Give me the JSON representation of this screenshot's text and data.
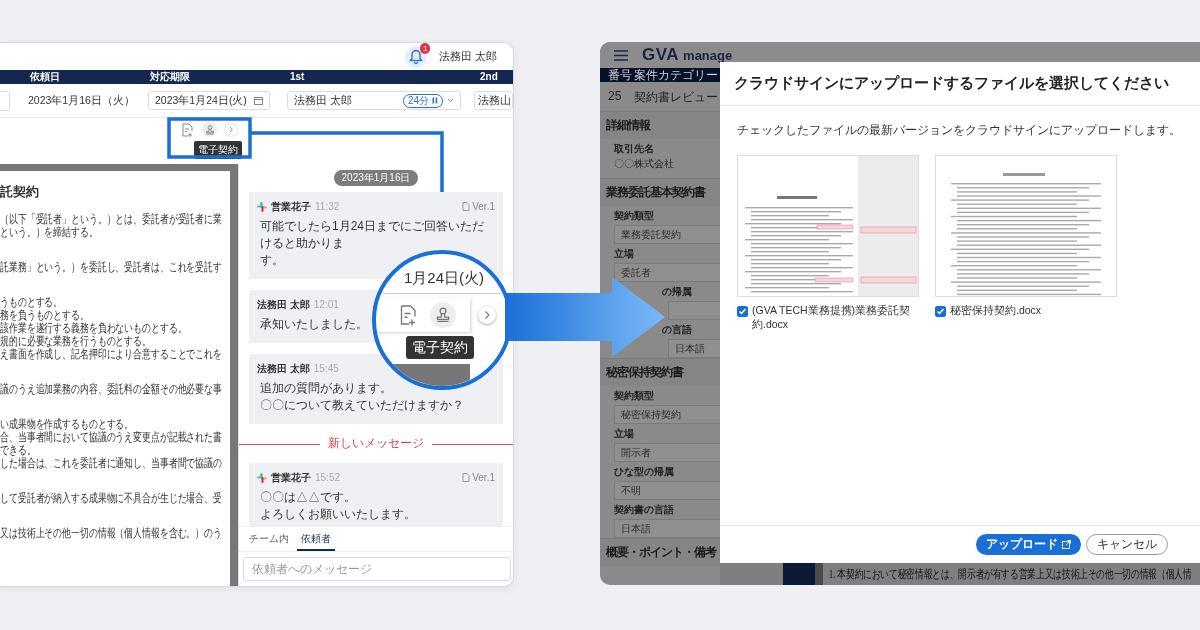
{
  "left_window": {
    "user": {
      "name": "法務田 太郎",
      "notifications": "1"
    },
    "columns": [
      "依頼日",
      "対応期限",
      "1st",
      "2nd"
    ],
    "filters": {
      "request_date": "2023年1月16日（火）",
      "deadline": "2023年1月24日(火)",
      "first_assignee": "法務田 太郎",
      "timer": "24分",
      "second_assignee": "法務山"
    },
    "toolbar_tooltip": "電子契約",
    "document": {
      "title": "託契約",
      "paragraphs": [
        [
          "（以下「受託者」という。）とは、委託者が受託者に業",
          "という。）を締結する。"
        ],
        [
          "託業務」という。）を委託し、受託者は、これを受託す"
        ],
        [
          "うものとする。",
          "務を負うものとする。",
          "該作業を遂行する義務を負わないものとする。",
          "規的に必要な業務を行うものとする。",
          "え書面を作成し、記名押印により合意することでこれを"
        ],
        [
          "議のうえ追加業務の内容、委託料の金額その他必要な事"
        ],
        [
          "い成果物を作成するものとする。",
          "合、当事者間において協議のうえ変更点が記載された書",
          "できる。",
          "した場合は、これを委託者に通知し、当事者間で協議の"
        ],
        [
          "して受託者が納入する成果物に不具合が生じた場合、受"
        ],
        [
          "又は技術上その他一切の情報（個人情報を含む。）のう"
        ]
      ]
    },
    "chat": {
      "date": "2023年1月16日",
      "new_messages_label": "新しいメッセージ",
      "messages": [
        {
          "kind": "slack",
          "sender": "営業花子",
          "time": "11:32",
          "version": "Ver.1",
          "unread_start": false,
          "lines": [
            "可能でしたら1月24日までにご回答いただけると助かりま",
            "す。"
          ]
        },
        {
          "kind": "plain",
          "sender": "法務田 太郎",
          "time": "12:01",
          "unread_start": false,
          "lines": [
            "承知いたしました。"
          ]
        },
        {
          "kind": "plain",
          "sender": "法務田 太郎",
          "time": "15:45",
          "unread_start": false,
          "lines": [
            "追加の質問があります。",
            "〇〇について教えていただけますか？"
          ]
        },
        {
          "kind": "slack",
          "sender": "営業花子",
          "time": "15:52",
          "version": "Ver.1",
          "unread_start": true,
          "lines": [
            "〇〇は△△です。",
            "よろしくお願いいたします。"
          ]
        }
      ],
      "tabs": [
        {
          "label": "チーム内",
          "selected": false
        },
        {
          "label": "依頼者",
          "selected": true
        }
      ],
      "input": {
        "placeholder": "依頼者へのメッセージ"
      }
    }
  },
  "magnifier": {
    "date": "1月24日(火)",
    "tooltip": "電子契約"
  },
  "right_window": {
    "brand": {
      "name": "GVA",
      "suffix": "manage"
    },
    "table": {
      "columns": [
        "番号",
        "案件カテゴリー"
      ],
      "row": [
        "25",
        "契約書レビュー"
      ]
    },
    "sidebar": [
      {
        "title": "詳細情報",
        "fields": [
          {
            "kind": "text",
            "label": "取引先名",
            "value": "〇〇株式会社"
          }
        ]
      },
      {
        "title": "業務委託基本契約書",
        "fields": [
          {
            "kind": "input",
            "label": "契約類型",
            "value": "業務委託契約"
          },
          {
            "kind": "input",
            "label": "立場",
            "value": "委託者"
          },
          {
            "kind": "input",
            "label": "の帰属",
            "clipped": true
          },
          {
            "kind": "input",
            "label": "の言語",
            "value": "日本語",
            "clipped": true
          }
        ]
      },
      {
        "title": "秘密保持契約書",
        "fields": [
          {
            "kind": "input",
            "label": "契約類型",
            "value": "秘密保持契約"
          },
          {
            "kind": "input",
            "label": "立場",
            "value": "開示者"
          },
          {
            "kind": "input",
            "label": "ひな型の帰属",
            "value": "不明"
          },
          {
            "kind": "input",
            "label": "契約書の言語",
            "value": "日本語"
          }
        ]
      },
      {
        "title": "概要・ポイント・備考"
      }
    ],
    "dialog": {
      "title": "クラウドサインにアップロードするファイルを選択してください",
      "description": "チェックしたファイルの最新バージョンをクラウドサインにアップロードします。",
      "files": [
        {
          "name": "(GVA TECH業務提携)業務委託契約.docx",
          "checked": true,
          "kind": "commented"
        },
        {
          "name": "秘密保持契約.docx",
          "checked": true,
          "kind": "plain"
        }
      ],
      "buttons": [
        {
          "label": "アップロード",
          "kind": "primary"
        },
        {
          "label": "キャンセル",
          "kind": "secondary"
        }
      ]
    },
    "background_text": "1. 本契約において秘密情報とは、開示者が有する営業上又は技術上その他一切の情報（個人情"
  }
}
